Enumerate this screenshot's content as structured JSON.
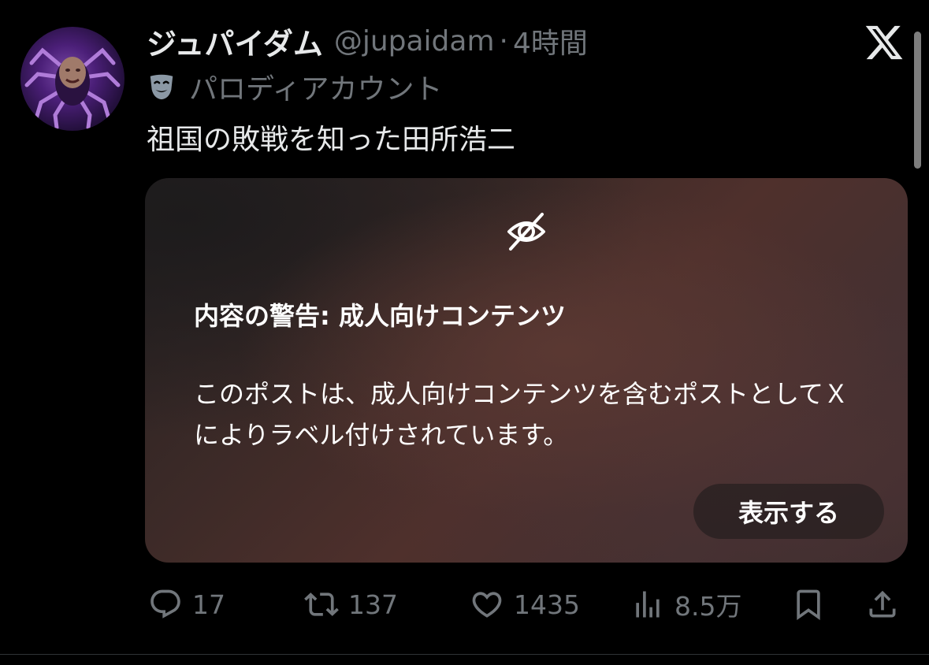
{
  "author": {
    "display_name": "ジュパイダム",
    "handle": "@jupaidam",
    "separator": "·",
    "time": "4時間",
    "parody_label": "パロディアカウント"
  },
  "tweet": {
    "text": "祖国の敗戦を知った田所浩二"
  },
  "media_warning": {
    "title": "内容の警告: 成人向けコンテンツ",
    "body": "このポストは、成人向けコンテンツを含むポストとしてＸによりラベル付けされています。",
    "show_button": "表示する"
  },
  "actions": {
    "replies": "17",
    "reposts": "137",
    "likes": "1435",
    "views": "8.5万"
  },
  "icons": {
    "reply": "reply-icon",
    "repost": "repost-icon",
    "like": "heart-icon",
    "views": "views-icon",
    "bookmark": "bookmark-icon",
    "share": "share-icon",
    "brand": "x-logo-icon",
    "parody": "mask-icon",
    "hidden": "eye-off-icon"
  },
  "colors": {
    "background": "#000000",
    "text_primary": "#e7e9ea",
    "text_secondary": "#71767b"
  }
}
